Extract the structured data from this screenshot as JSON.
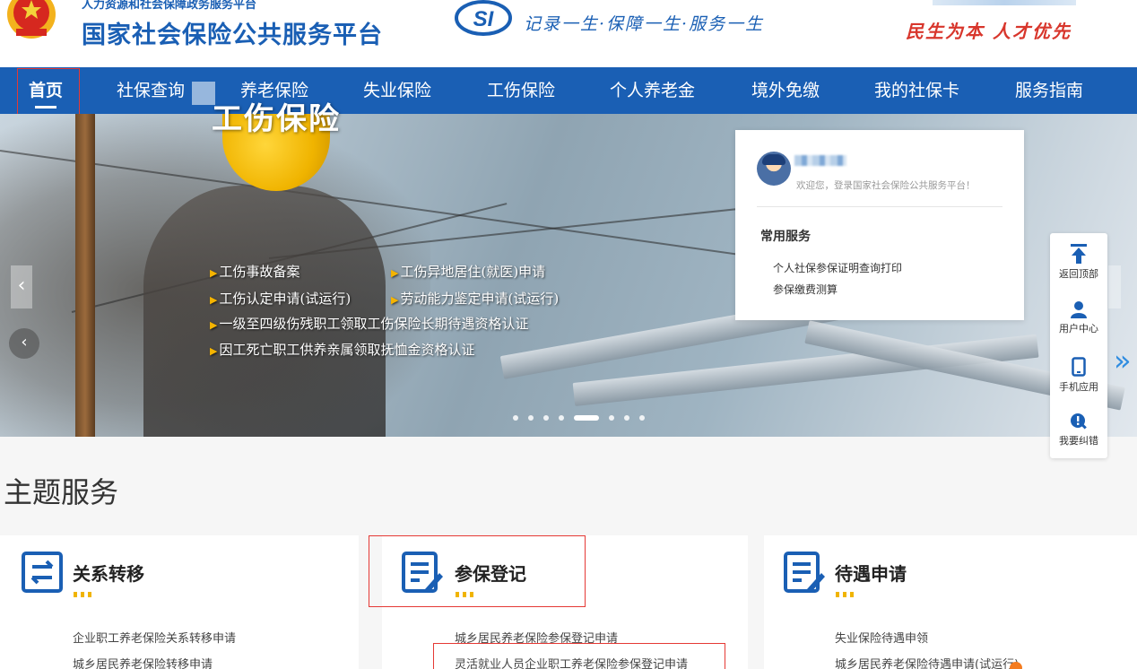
{
  "header": {
    "org_name": "人力资源和社会保障政务服务平台",
    "site_title": "国家社会保险公共服务平台",
    "slogan": "记录一生·保障一生·服务一生",
    "motto": "民生为本 人才优先",
    "colors": {
      "brand_blue": "#1a5fb4",
      "motto_red": "#d8362c"
    }
  },
  "nav": {
    "items": [
      {
        "label": "首页",
        "active": true
      },
      {
        "label": "社保查询"
      },
      {
        "label": "养老保险"
      },
      {
        "label": "失业保险"
      },
      {
        "label": "工伤保险"
      },
      {
        "label": "个人养老金"
      },
      {
        "label": "境外免缴"
      },
      {
        "label": "我的社保卡"
      },
      {
        "label": "服务指南"
      }
    ]
  },
  "banner": {
    "title": "工伤保险",
    "lines": [
      "工伤事故备案",
      "工伤异地居住(就医)申请",
      "工伤认定申请(试运行)",
      "劳动能力鉴定申请(试运行)",
      "一级至四级伤残职工领取工伤保险长期待遇资格认证",
      "因工死亡职工供养亲属领取抚恤金资格认证"
    ],
    "slide_count": 8,
    "active_slide": 5
  },
  "login_card": {
    "welcome": "欢迎您，登录国家社会保险公共服务平台！",
    "common_title": "常用服务",
    "links": [
      "个人社保参保证明查询打印",
      "参保缴费测算"
    ]
  },
  "sidebar": {
    "items": [
      {
        "label": "返回顶部",
        "icon": "back-to-top-icon"
      },
      {
        "label": "用户中心",
        "icon": "user-icon"
      },
      {
        "label": "手机应用",
        "icon": "mobile-icon"
      },
      {
        "label": "我要纠错",
        "icon": "error-report-icon"
      }
    ]
  },
  "themes": {
    "title": "主题服务",
    "cards": [
      {
        "title": "关系转移",
        "icon": "transfer-icon",
        "links": [
          "企业职工养老保险关系转移申请",
          "城乡居民养老保险转移申请"
        ]
      },
      {
        "title": "参保登记",
        "icon": "register-icon",
        "links": [
          "城乡居民养老保险参保登记申请",
          "灵活就业人员企业职工养老保险参保登记申请"
        ]
      },
      {
        "title": "待遇申请",
        "icon": "benefit-icon",
        "links": [
          "失业保险待遇申领",
          "城乡居民养老保险待遇申请(试运行)"
        ]
      }
    ]
  }
}
